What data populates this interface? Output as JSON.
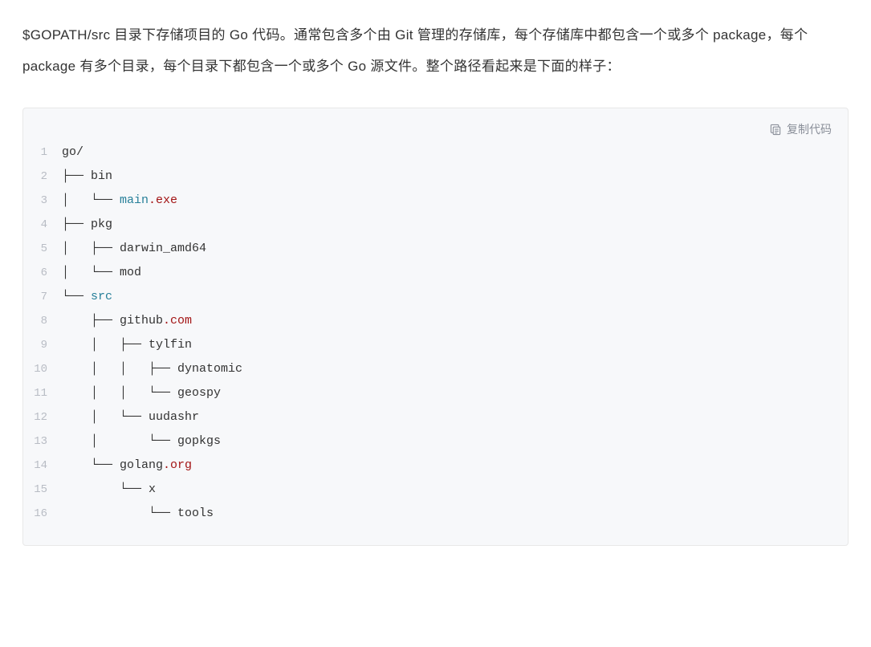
{
  "description": "$GOPATH/src 目录下存储项目的 Go 代码。通常包含多个由 Git 管理的存储库，每个存储库中都包含一个或多个 package，每个 package 有多个目录，每个目录下都包含一个或多个 Go 源文件。整个路径看起来是下面的样子：",
  "copy_button_label": "复制代码",
  "code_lines": [
    {
      "num": "1",
      "segments": [
        {
          "text": "go/",
          "class": ""
        }
      ]
    },
    {
      "num": "2",
      "segments": [
        {
          "text": "├── bin",
          "class": ""
        }
      ]
    },
    {
      "num": "3",
      "segments": [
        {
          "text": "│   └── ",
          "class": ""
        },
        {
          "text": "main",
          "class": "token-teal"
        },
        {
          "text": ".exe",
          "class": "token-redbrown"
        }
      ]
    },
    {
      "num": "4",
      "segments": [
        {
          "text": "├── pkg",
          "class": ""
        }
      ]
    },
    {
      "num": "5",
      "segments": [
        {
          "text": "│   ├── darwin_amd64",
          "class": ""
        }
      ]
    },
    {
      "num": "6",
      "segments": [
        {
          "text": "│   └── mod",
          "class": ""
        }
      ]
    },
    {
      "num": "7",
      "segments": [
        {
          "text": "└── ",
          "class": ""
        },
        {
          "text": "src",
          "class": "token-teal"
        }
      ]
    },
    {
      "num": "8",
      "segments": [
        {
          "text": "    ├── github",
          "class": ""
        },
        {
          "text": ".com",
          "class": "token-redbrown"
        }
      ]
    },
    {
      "num": "9",
      "segments": [
        {
          "text": "    │   ├── tylfin",
          "class": ""
        }
      ]
    },
    {
      "num": "10",
      "segments": [
        {
          "text": "    │   │   ├── dynatomic",
          "class": ""
        }
      ]
    },
    {
      "num": "11",
      "segments": [
        {
          "text": "    │   │   └── geospy",
          "class": ""
        }
      ]
    },
    {
      "num": "12",
      "segments": [
        {
          "text": "    │   └── uudashr",
          "class": ""
        }
      ]
    },
    {
      "num": "13",
      "segments": [
        {
          "text": "    │       └── gopkgs",
          "class": ""
        }
      ]
    },
    {
      "num": "14",
      "segments": [
        {
          "text": "    └── golang",
          "class": ""
        },
        {
          "text": ".org",
          "class": "token-redbrown"
        }
      ]
    },
    {
      "num": "15",
      "segments": [
        {
          "text": "        └── x",
          "class": ""
        }
      ]
    },
    {
      "num": "16",
      "segments": [
        {
          "text": "            └── tools",
          "class": ""
        }
      ]
    }
  ]
}
